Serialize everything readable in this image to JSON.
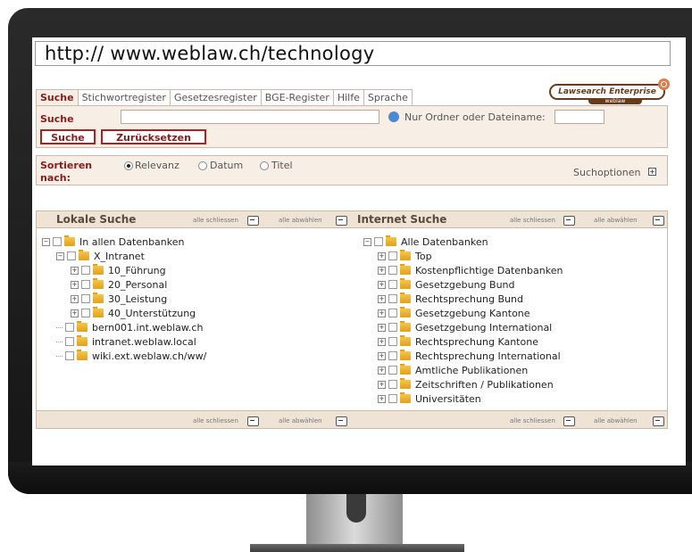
{
  "url": "http:// www.weblaw.ch/technology",
  "tabs": [
    "Suche",
    "Stichwortregister",
    "Gesetzesregister",
    "BGE-Register",
    "Hilfe",
    "Sprache"
  ],
  "logo": {
    "title": "Lawsearch Enterprise",
    "subtitle": "weblaw"
  },
  "search": {
    "label": "Suche",
    "query": "",
    "option_label": "Nur Ordner oder Dateiname:",
    "option_value": "",
    "search_button": "Suche",
    "reset_button": "Zurücksetzen"
  },
  "sort": {
    "label_line1": "Sortieren",
    "label_line2": "nach:",
    "options": [
      {
        "label": "Relevanz",
        "selected": true
      },
      {
        "label": "Datum",
        "selected": false
      },
      {
        "label": "Titel",
        "selected": false
      }
    ],
    "search_options": "Suchoptionen"
  },
  "local": {
    "title": "Lokale Suche",
    "close_all": "alle schliessen",
    "deselect_all": "alle abwählen",
    "tree": [
      {
        "label": "In allen Datenbanken",
        "level": 0,
        "expander": "−"
      },
      {
        "label": "X_Intranet",
        "level": 1,
        "expander": "−"
      },
      {
        "label": "10_Führung",
        "level": 2,
        "expander": "+"
      },
      {
        "label": "20_Personal",
        "level": 2,
        "expander": "+"
      },
      {
        "label": "30_Leistung",
        "level": 2,
        "expander": "+"
      },
      {
        "label": "40_Unterstützung",
        "level": 2,
        "expander": "+"
      },
      {
        "label": "bern001.int.weblaw.ch",
        "level": 1,
        "expander": ""
      },
      {
        "label": "intranet.weblaw.local",
        "level": 1,
        "expander": ""
      },
      {
        "label": "wiki.ext.weblaw.ch/ww/",
        "level": 1,
        "expander": ""
      }
    ]
  },
  "internet": {
    "title": "Internet Suche",
    "close_all": "alle schliessen",
    "deselect_all": "alle abwählen",
    "tree": [
      {
        "label": "Alle Datenbanken",
        "level": 0,
        "expander": "−"
      },
      {
        "label": "Top",
        "level": 1,
        "expander": "+"
      },
      {
        "label": "Kostenpflichtige Datenbanken",
        "level": 1,
        "expander": "+"
      },
      {
        "label": "Gesetzgebung Bund",
        "level": 1,
        "expander": "+"
      },
      {
        "label": "Rechtsprechung Bund",
        "level": 1,
        "expander": "+"
      },
      {
        "label": "Gesetzgebung Kantone",
        "level": 1,
        "expander": "+"
      },
      {
        "label": "Gesetzgebung International",
        "level": 1,
        "expander": "+"
      },
      {
        "label": "Rechtsprechung Kantone",
        "level": 1,
        "expander": "+"
      },
      {
        "label": "Rechtsprechung International",
        "level": 1,
        "expander": "+"
      },
      {
        "label": "Amtliche Publikationen",
        "level": 1,
        "expander": "+"
      },
      {
        "label": "Zeitschriften / Publikationen",
        "level": 1,
        "expander": "+"
      },
      {
        "label": "Universitäten",
        "level": 1,
        "expander": "+"
      }
    ]
  },
  "footer": {
    "close_all": "alle schliessen",
    "deselect_all": "alle abwählen"
  }
}
